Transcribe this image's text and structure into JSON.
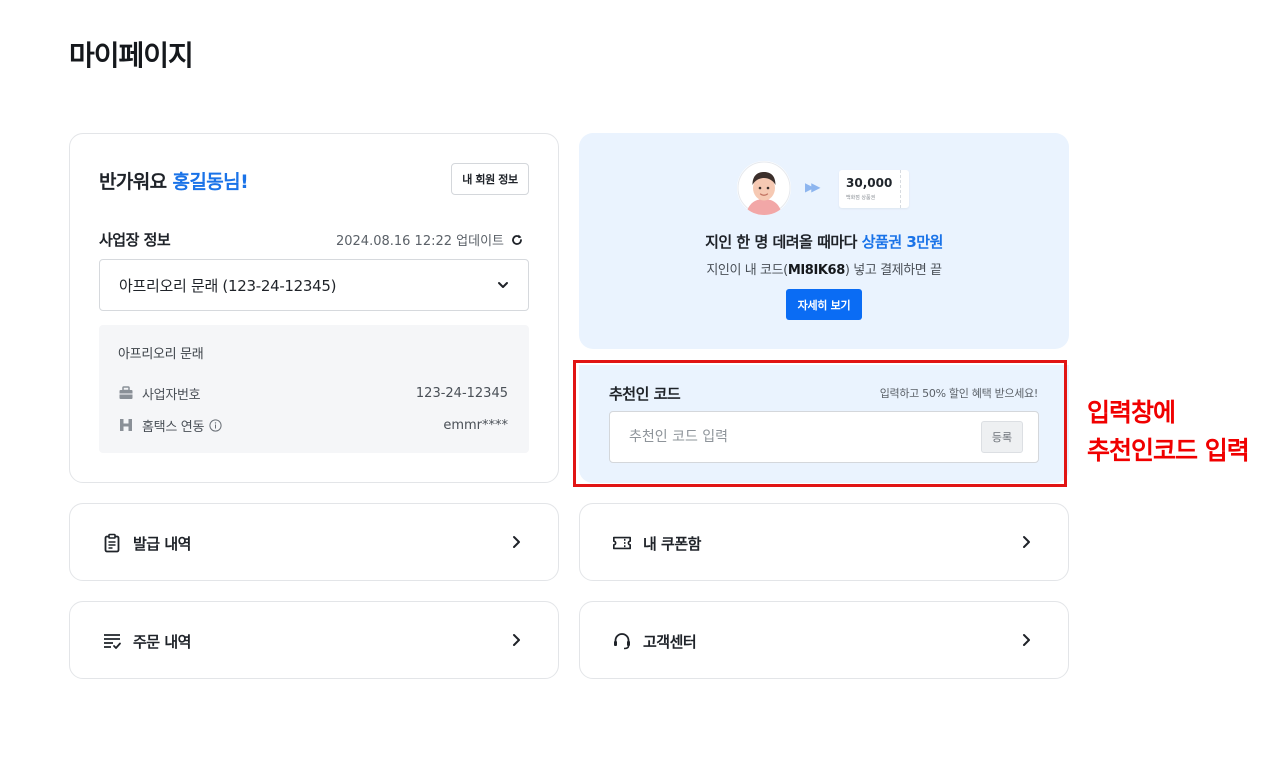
{
  "page": {
    "title": "마이페이지"
  },
  "profile": {
    "greeting_prefix": "반가워요",
    "user_name": "홍길동님!",
    "member_info_button": "내 회원 정보",
    "business_info_label": "사업장 정보",
    "updated_at": "2024.08.16 12:22 업데이트",
    "selected_business": "아프리오리 문래 (123-24-12345)",
    "detail": {
      "name": "아프리오리 문래",
      "business_number_label": "사업자번호",
      "business_number": "123-24-12345",
      "hometax_label": "홈택스 연동",
      "hometax_account": "emmr****"
    }
  },
  "promo": {
    "coupon_amount": "30,000",
    "coupon_caption": "백화점 상품권",
    "headline_prefix": "지인 한 명 데려올 때마다",
    "headline_highlight": "상품권 3만원",
    "sub_prefix": "지인이 내 코드(",
    "sub_code": "MI8IK68",
    "sub_suffix": ") 넣고 결제하면 끝",
    "detail_button": "자세히 보기"
  },
  "referral": {
    "title": "추천인 코드",
    "hint": "입력하고 50% 할인 혜택 받으세요!",
    "placeholder": "추천인 코드 입력",
    "submit": "등록"
  },
  "annotation": {
    "line1": "입력창에",
    "line2": "추천인코드 입력",
    "color": "#f00000"
  },
  "menu": {
    "issue_history": "발급 내역",
    "coupon_box": "내 쿠폰함",
    "order_history": "주문 내역",
    "customer_center": "고객센터"
  },
  "colors": {
    "accent": "#1a73e8",
    "button_primary": "#0a6cf4",
    "promo_bg": "#eaf3fe"
  }
}
